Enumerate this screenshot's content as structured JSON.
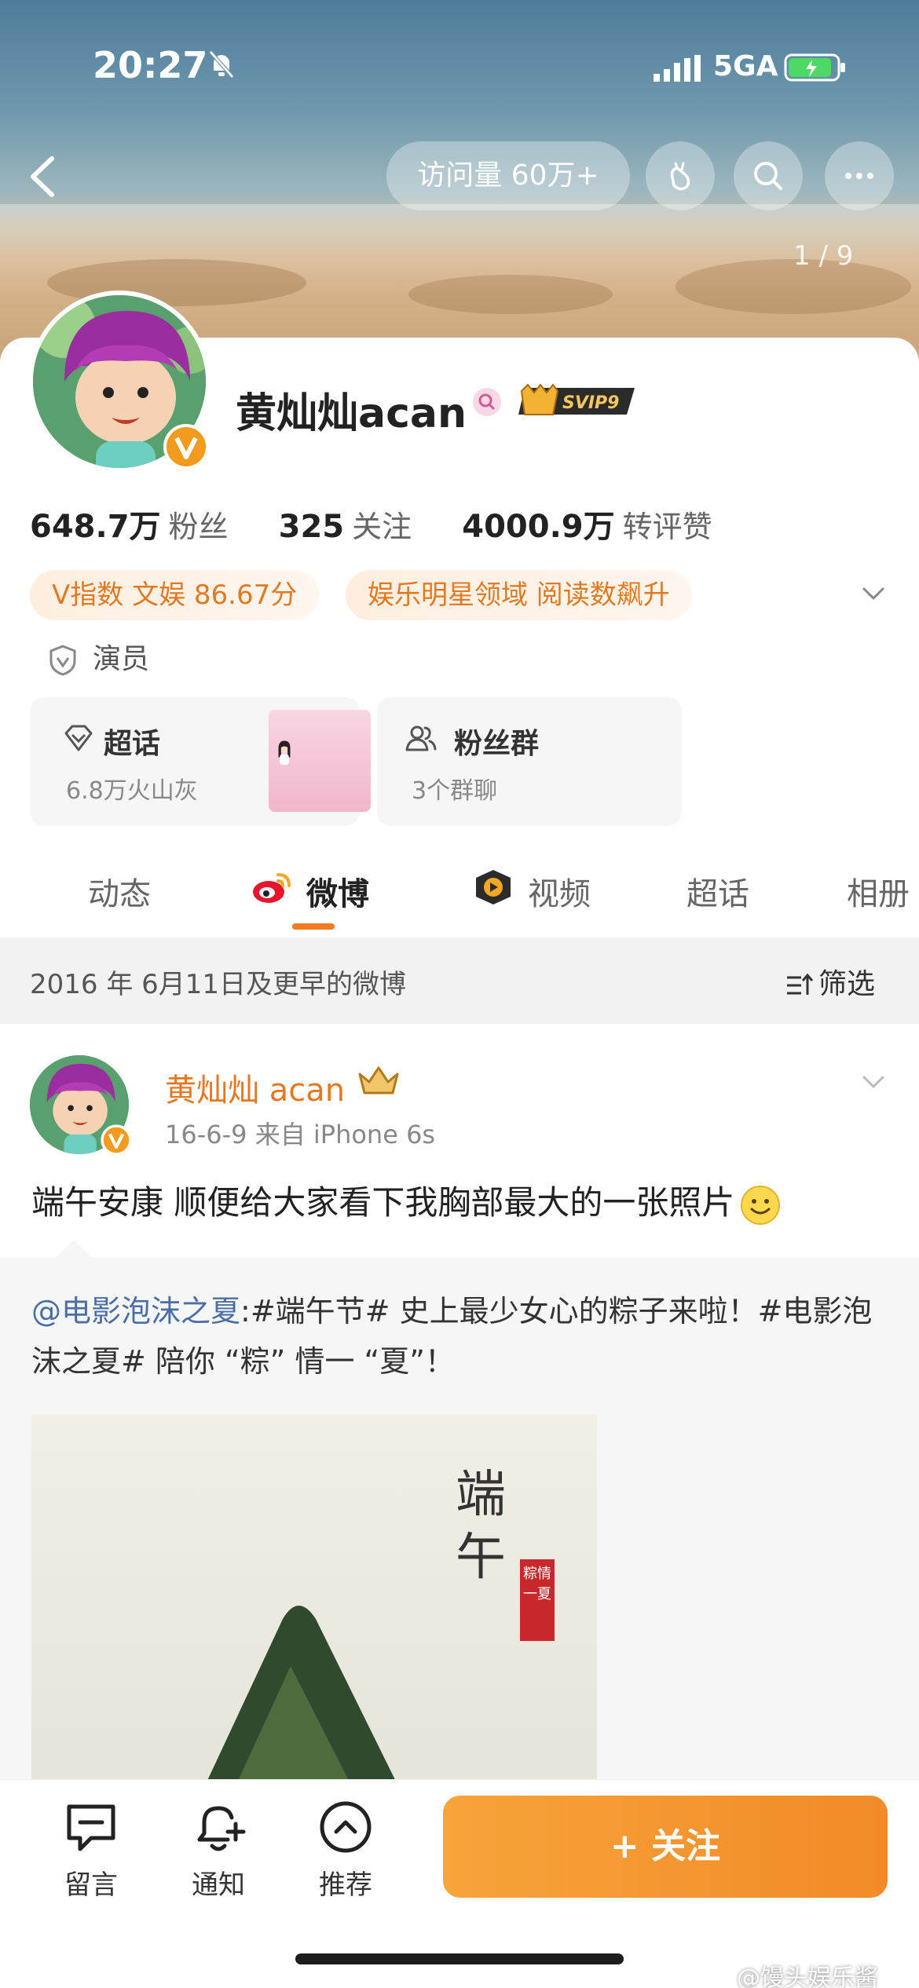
{
  "status_bar": {
    "time": "20:27",
    "network": "5GA"
  },
  "header": {
    "visits_label": "访问量 60万+",
    "photo_counter": "1 / 9"
  },
  "profile": {
    "name": "黄灿灿acan",
    "vip_badge": "SVIP9",
    "stats": [
      {
        "num": "648.7万",
        "label": "粉丝"
      },
      {
        "num": "325",
        "label": "关注"
      },
      {
        "num": "4000.9万",
        "label": "转评赞"
      }
    ],
    "tags": [
      "V指数 文娱 86.67分",
      "娱乐明星领域 阅读数飙升"
    ],
    "role": "演员",
    "super_topic": {
      "title": "超话",
      "sub": "6.8万火山灰"
    },
    "fan_group": {
      "title": "粉丝群",
      "sub": "3个群聊"
    }
  },
  "tabs": [
    "动态",
    "微博",
    "视频",
    "超话",
    "相册"
  ],
  "active_tab": "微博",
  "filter": {
    "text": "2016 年 6月11日及更早的微博",
    "button": "筛选"
  },
  "post": {
    "author": "黄灿灿 acan",
    "meta": "16-6-9  来自 iPhone 6s",
    "text": "端午安康 顺便给大家看下我胸部最大的一张照片",
    "repost": {
      "mention": "@电影泡沫之夏",
      "body": ":#端午节# 史上最少女心的粽子来啦！#电影泡沫之夏# 陪你 “粽” 情一 “夏”！"
    },
    "poster_title": "端午",
    "poster_seal": "粽情一夏"
  },
  "bottom_bar": {
    "comment": "留言",
    "notify": "通知",
    "recommend": "推荐",
    "follow": "+ 关注"
  },
  "watermark": "@馒头娱乐酱",
  "colors": {
    "accent": "#f17a22",
    "follow_button": "#f39a33",
    "link": "#4a6fa5",
    "author": "#e87722"
  }
}
